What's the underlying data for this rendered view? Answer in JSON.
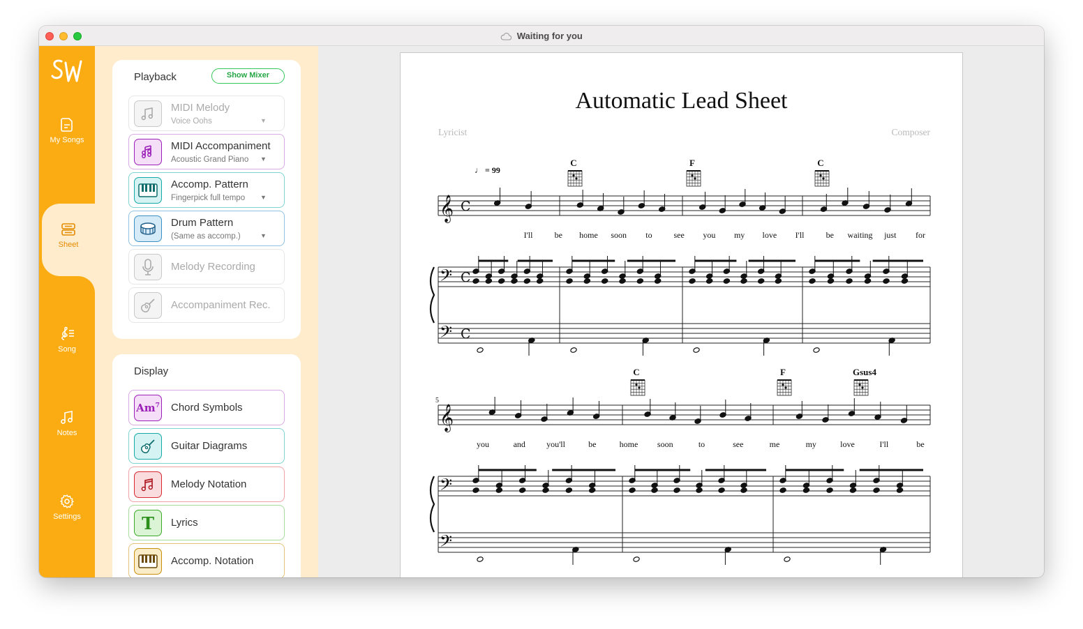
{
  "window": {
    "title": "Waiting for you"
  },
  "rail": {
    "logo": "SW",
    "items": [
      {
        "label": "My Songs",
        "icon": "document-icon"
      },
      {
        "label": "Sheet",
        "icon": "sheet-icon",
        "active": true
      },
      {
        "label": "Song",
        "icon": "treble-clef-list-icon"
      },
      {
        "label": "Notes",
        "icon": "music-note-icon"
      },
      {
        "label": "Settings",
        "icon": "gear-icon"
      }
    ]
  },
  "playback": {
    "title": "Playback",
    "mixer_label": "Show Mixer",
    "rows": [
      {
        "label": "MIDI Melody",
        "sub": "Voice Oohs",
        "enabled": false
      },
      {
        "label": "MIDI Accompaniment",
        "sub": "Acoustic Grand Piano",
        "enabled": true
      },
      {
        "label": "Accomp. Pattern",
        "sub": "Fingerpick full tempo",
        "enabled": true
      },
      {
        "label": "Drum Pattern",
        "sub": "(Same as accomp.)",
        "enabled": true
      },
      {
        "label": "Melody Recording",
        "enabled": false
      },
      {
        "label": "Accompaniment Rec.",
        "enabled": false
      }
    ]
  },
  "display": {
    "title": "Display",
    "rows": [
      {
        "label": "Chord Symbols",
        "icon_text": "Am",
        "icon_sup": "7"
      },
      {
        "label": "Guitar Diagrams"
      },
      {
        "label": "Melody Notation"
      },
      {
        "label": "Lyrics",
        "icon_text": "T"
      },
      {
        "label": "Accomp. Notation"
      }
    ]
  },
  "colors": {
    "rail": "#fbac12",
    "panel_bg": "#ffeccc",
    "purple": "#9b1fb8",
    "teal": "#14a8a6",
    "blue": "#3a8fc7",
    "red": "#d9262f",
    "green": "#3aaa27",
    "gold": "#b8860b",
    "mixer_green": "#34c759"
  },
  "sheet": {
    "title": "Automatic Lead Sheet",
    "lyricist": "Lyricist",
    "composer": "Composer",
    "tempo": "♩ = 99",
    "systems": [
      {
        "measure_number": "",
        "chords": [
          "C",
          "F",
          "C"
        ],
        "lyrics": [
          "I'll",
          "be",
          "home",
          "soon",
          "to",
          "see",
          "you",
          "my",
          "love",
          "I'll",
          "be",
          "waiting",
          "just",
          "for"
        ]
      },
      {
        "measure_number": "5",
        "chords": [
          "C",
          "F",
          "Gsus4"
        ],
        "lyrics": [
          "you",
          "and",
          "you'll",
          "be",
          "home",
          "soon",
          "to",
          "see",
          "me",
          "my",
          "love",
          "I'll",
          "be"
        ]
      }
    ]
  }
}
